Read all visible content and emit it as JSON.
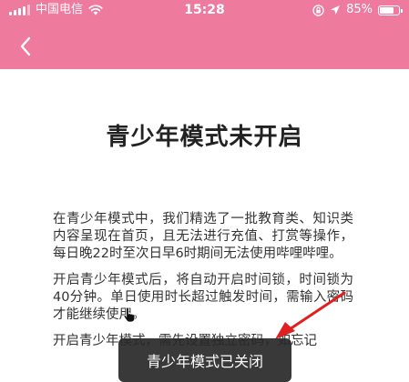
{
  "status_bar": {
    "carrier": "中国电信",
    "time": "15:28",
    "battery_percent": "85%",
    "battery_level": 0.85,
    "icons": [
      "signal-icon",
      "wifi-icon",
      "screen-lock-icon",
      "location-icon",
      "battery-icon"
    ]
  },
  "nav": {
    "back_icon": "chevron-left-icon",
    "background_color": "#ee7b9e"
  },
  "page": {
    "title": "青少年模式未开启",
    "paragraphs": [
      "在青少年模式中，我们精选了一批教育类、知识类内容呈现在首页，且无法进行充值、打赏等操作，每日晚22时至次日早6时期间无法使用哔哩哔哩。",
      "开启青少年模式后，将自动开启时间锁，时间锁为40分钟。单日使用时长超过触发时间，需输入密码才能继续使用。",
      "开启青少年模式，需先设置独立密码，如忘记"
    ]
  },
  "toast": {
    "message": "青少年模式已关闭"
  },
  "annotation": {
    "arrow_color": "#e02020"
  }
}
